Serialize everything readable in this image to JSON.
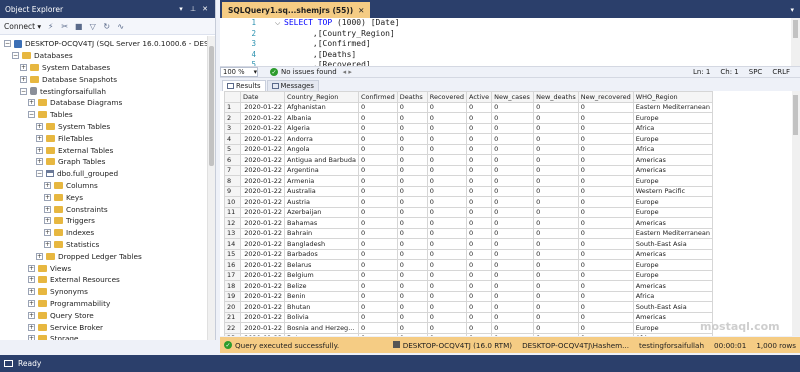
{
  "object_explorer": {
    "title": "Object Explorer",
    "connect_label": "Connect",
    "tree": [
      {
        "label": "DESKTOP-OCQV4TJ (SQL Server 16.0.1000.6 - DESKTOP",
        "indent": 0,
        "exp": "−",
        "icon": "srv"
      },
      {
        "label": "Databases",
        "indent": 1,
        "exp": "−",
        "icon": "fld"
      },
      {
        "label": "System Databases",
        "indent": 2,
        "exp": "+",
        "icon": "fld"
      },
      {
        "label": "Database Snapshots",
        "indent": 2,
        "exp": "+",
        "icon": "fld"
      },
      {
        "label": "testingforsaifullah",
        "indent": 2,
        "exp": "−",
        "icon": "dbi"
      },
      {
        "label": "Database Diagrams",
        "indent": 3,
        "exp": "+",
        "icon": "fld"
      },
      {
        "label": "Tables",
        "indent": 3,
        "exp": "−",
        "icon": "fld"
      },
      {
        "label": "System Tables",
        "indent": 4,
        "exp": "+",
        "icon": "fld"
      },
      {
        "label": "FileTables",
        "indent": 4,
        "exp": "+",
        "icon": "fld"
      },
      {
        "label": "External Tables",
        "indent": 4,
        "exp": "+",
        "icon": "fld"
      },
      {
        "label": "Graph Tables",
        "indent": 4,
        "exp": "+",
        "icon": "fld"
      },
      {
        "label": "dbo.full_grouped",
        "indent": 4,
        "exp": "−",
        "icon": "tbi"
      },
      {
        "label": "Columns",
        "indent": 5,
        "exp": "+",
        "icon": "fld"
      },
      {
        "label": "Keys",
        "indent": 5,
        "exp": "+",
        "icon": "fld"
      },
      {
        "label": "Constraints",
        "indent": 5,
        "exp": "+",
        "icon": "fld"
      },
      {
        "label": "Triggers",
        "indent": 5,
        "exp": "+",
        "icon": "fld"
      },
      {
        "label": "Indexes",
        "indent": 5,
        "exp": "+",
        "icon": "fld"
      },
      {
        "label": "Statistics",
        "indent": 5,
        "exp": "+",
        "icon": "fld"
      },
      {
        "label": "Dropped Ledger Tables",
        "indent": 4,
        "exp": "+",
        "icon": "fld"
      },
      {
        "label": "Views",
        "indent": 3,
        "exp": "+",
        "icon": "fld"
      },
      {
        "label": "External Resources",
        "indent": 3,
        "exp": "+",
        "icon": "fld"
      },
      {
        "label": "Synonyms",
        "indent": 3,
        "exp": "+",
        "icon": "fld"
      },
      {
        "label": "Programmability",
        "indent": 3,
        "exp": "+",
        "icon": "fld"
      },
      {
        "label": "Query Store",
        "indent": 3,
        "exp": "+",
        "icon": "fld"
      },
      {
        "label": "Service Broker",
        "indent": 3,
        "exp": "+",
        "icon": "fld"
      },
      {
        "label": "Storage",
        "indent": 3,
        "exp": "+",
        "icon": "fld"
      }
    ]
  },
  "editor": {
    "tab_label": "SQLQuery1.sq...shemjrs (55))",
    "line_numbers": [
      "1",
      "2",
      "3",
      "4",
      "5"
    ],
    "lines": [
      {
        "kw": "SELECT TOP",
        "rest": " (1000) [Date]"
      },
      {
        "kw": "",
        "rest": "      ,[Country_Region]"
      },
      {
        "kw": "",
        "rest": "      ,[Confirmed]"
      },
      {
        "kw": "",
        "rest": "      ,[Deaths]"
      },
      {
        "kw": "",
        "rest": "      ,[Recovered]"
      }
    ],
    "zoom": "100 %",
    "issues": "No issues found",
    "ln": "Ln: 1",
    "ch": "Ch: 1",
    "spc": "SPC",
    "crlf": "CRLF"
  },
  "results": {
    "tab_results": "Results",
    "tab_messages": "Messages",
    "columns": [
      "",
      "Date",
      "Country_Region",
      "Confirmed",
      "Deaths",
      "Recovered",
      "Active",
      "New_cases",
      "New_deaths",
      "New_recovered",
      "WHO_Region"
    ],
    "rows": [
      [
        "1",
        "2020-01-22",
        "Afghanistan",
        "0",
        "0",
        "0",
        "0",
        "0",
        "0",
        "0",
        "Eastern Mediterranean"
      ],
      [
        "2",
        "2020-01-22",
        "Albania",
        "0",
        "0",
        "0",
        "0",
        "0",
        "0",
        "0",
        "Europe"
      ],
      [
        "3",
        "2020-01-22",
        "Algeria",
        "0",
        "0",
        "0",
        "0",
        "0",
        "0",
        "0",
        "Africa"
      ],
      [
        "4",
        "2020-01-22",
        "Andorra",
        "0",
        "0",
        "0",
        "0",
        "0",
        "0",
        "0",
        "Europe"
      ],
      [
        "5",
        "2020-01-22",
        "Angola",
        "0",
        "0",
        "0",
        "0",
        "0",
        "0",
        "0",
        "Africa"
      ],
      [
        "6",
        "2020-01-22",
        "Antigua and Barbuda",
        "0",
        "0",
        "0",
        "0",
        "0",
        "0",
        "0",
        "Americas"
      ],
      [
        "7",
        "2020-01-22",
        "Argentina",
        "0",
        "0",
        "0",
        "0",
        "0",
        "0",
        "0",
        "Americas"
      ],
      [
        "8",
        "2020-01-22",
        "Armenia",
        "0",
        "0",
        "0",
        "0",
        "0",
        "0",
        "0",
        "Europe"
      ],
      [
        "9",
        "2020-01-22",
        "Australia",
        "0",
        "0",
        "0",
        "0",
        "0",
        "0",
        "0",
        "Western Pacific"
      ],
      [
        "10",
        "2020-01-22",
        "Austria",
        "0",
        "0",
        "0",
        "0",
        "0",
        "0",
        "0",
        "Europe"
      ],
      [
        "11",
        "2020-01-22",
        "Azerbaijan",
        "0",
        "0",
        "0",
        "0",
        "0",
        "0",
        "0",
        "Europe"
      ],
      [
        "12",
        "2020-01-22",
        "Bahamas",
        "0",
        "0",
        "0",
        "0",
        "0",
        "0",
        "0",
        "Americas"
      ],
      [
        "13",
        "2020-01-22",
        "Bahrain",
        "0",
        "0",
        "0",
        "0",
        "0",
        "0",
        "0",
        "Eastern Mediterranean"
      ],
      [
        "14",
        "2020-01-22",
        "Bangladesh",
        "0",
        "0",
        "0",
        "0",
        "0",
        "0",
        "0",
        "South-East Asia"
      ],
      [
        "15",
        "2020-01-22",
        "Barbados",
        "0",
        "0",
        "0",
        "0",
        "0",
        "0",
        "0",
        "Americas"
      ],
      [
        "16",
        "2020-01-22",
        "Belarus",
        "0",
        "0",
        "0",
        "0",
        "0",
        "0",
        "0",
        "Europe"
      ],
      [
        "17",
        "2020-01-22",
        "Belgium",
        "0",
        "0",
        "0",
        "0",
        "0",
        "0",
        "0",
        "Europe"
      ],
      [
        "18",
        "2020-01-22",
        "Belize",
        "0",
        "0",
        "0",
        "0",
        "0",
        "0",
        "0",
        "Americas"
      ],
      [
        "19",
        "2020-01-22",
        "Benin",
        "0",
        "0",
        "0",
        "0",
        "0",
        "0",
        "0",
        "Africa"
      ],
      [
        "20",
        "2020-01-22",
        "Bhutan",
        "0",
        "0",
        "0",
        "0",
        "0",
        "0",
        "0",
        "South-East Asia"
      ],
      [
        "21",
        "2020-01-22",
        "Bolivia",
        "0",
        "0",
        "0",
        "0",
        "0",
        "0",
        "0",
        "Americas"
      ],
      [
        "22",
        "2020-01-22",
        "Bosnia and Herzeg...",
        "0",
        "0",
        "0",
        "0",
        "0",
        "0",
        "0",
        "Europe"
      ],
      [
        "23",
        "2020-01-22",
        "Botswana",
        "0",
        "0",
        "0",
        "0",
        "0",
        "0",
        "0",
        "Africa"
      ]
    ]
  },
  "status": {
    "message": "Query executed successfully.",
    "server": "DESKTOP-OCQV4TJ (16.0 RTM)",
    "user": "DESKTOP-OCQV4TJ\\Hashem...",
    "database": "testingforsaifullah",
    "elapsed": "00:00:01",
    "rows": "1,000 rows"
  },
  "app_status": "Ready",
  "watermark": "mostaql.com",
  "colors": {
    "titlebar": "#2b3f6b",
    "tab_active": "#f5cc84",
    "success": "#2d9c2d"
  }
}
